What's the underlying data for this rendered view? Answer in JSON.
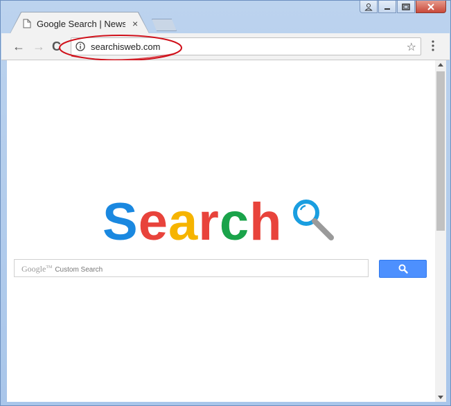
{
  "browser": {
    "tab": {
      "title": "Google Search | News se",
      "close_glyph": "×"
    },
    "address_bar": {
      "url": "searchisweb.com"
    },
    "nav": {
      "back": "←",
      "forward": "→",
      "reload": "C"
    },
    "star_glyph": "☆"
  },
  "page": {
    "logo": {
      "letters": [
        "S",
        "e",
        "a",
        "r",
        "c",
        "h"
      ],
      "colors": [
        "#1a88e0",
        "#e8433b",
        "#f6b400",
        "#e8433b",
        "#1aa34a",
        "#e8433b"
      ]
    },
    "search": {
      "brand": "Google",
      "tm": "TM",
      "placeholder": "Custom Search"
    },
    "search_button_color": "#4d90fe"
  },
  "annotation": {
    "color": "#d0101a"
  }
}
